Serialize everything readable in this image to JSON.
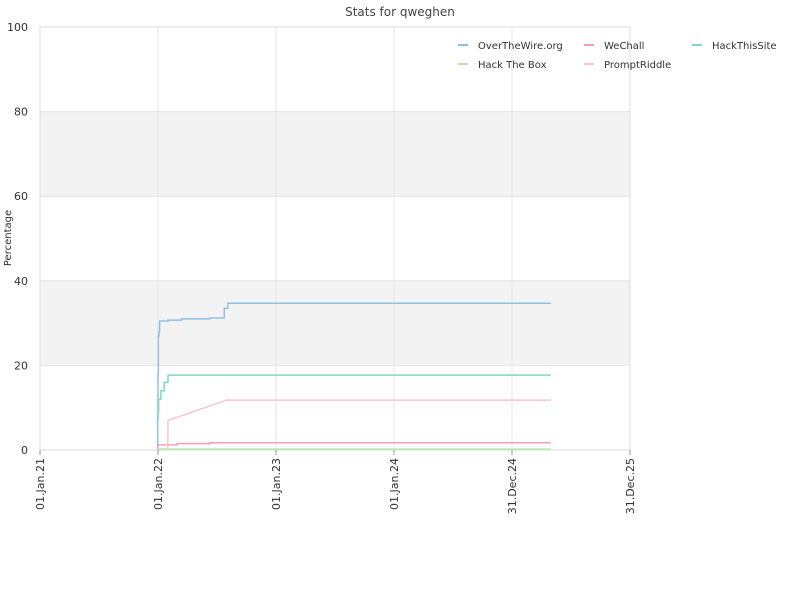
{
  "chart_data": {
    "type": "line",
    "title": "Stats for qweghen",
    "ylabel": "Percentage",
    "xlabel": "",
    "ylim": [
      0,
      100
    ],
    "yticks": [
      0,
      20,
      40,
      60,
      80,
      100
    ],
    "xlim": [
      "2021-01-01",
      "2025-12-31"
    ],
    "xticks": [
      {
        "date": "2021-01-01",
        "label": "01.Jan.21"
      },
      {
        "date": "2022-01-01",
        "label": "01.Jan.22"
      },
      {
        "date": "2023-01-01",
        "label": "01.Jan.23"
      },
      {
        "date": "2024-01-01",
        "label": "01.Jan.24"
      },
      {
        "date": "2024-12-31",
        "label": "31.Dec.24"
      },
      {
        "date": "2025-12-31",
        "label": "31.Dec.25"
      }
    ],
    "grid": true,
    "alternating_bands": true,
    "legend_position": "top-right",
    "series": [
      {
        "name": "OverTheWire.org",
        "color": "#8fbfe6",
        "step": true,
        "points": [
          [
            "2021-12-30",
            0
          ],
          [
            "2021-12-31",
            7
          ],
          [
            "2022-01-01",
            18
          ],
          [
            "2022-01-02",
            27
          ],
          [
            "2022-01-04",
            28
          ],
          [
            "2022-01-06",
            30.5
          ],
          [
            "2022-02-01",
            30.7
          ],
          [
            "2022-03-15",
            31
          ],
          [
            "2022-06-10",
            31.2
          ],
          [
            "2022-07-25",
            33.5
          ],
          [
            "2022-08-05",
            34.7
          ],
          [
            "2025-04-30",
            34.7
          ]
        ]
      },
      {
        "name": "WeChall",
        "color": "#f2a0b8",
        "step": true,
        "points": [
          [
            "2021-12-30",
            0
          ],
          [
            "2022-01-01",
            1.2
          ],
          [
            "2022-03-01",
            1.5
          ],
          [
            "2022-06-10",
            1.7
          ],
          [
            "2025-04-30",
            1.7
          ]
        ]
      },
      {
        "name": "HackThisSite",
        "color": "#7fd9c0",
        "step": true,
        "points": [
          [
            "2021-12-30",
            7
          ],
          [
            "2021-12-31",
            9
          ],
          [
            "2022-01-03",
            12
          ],
          [
            "2022-01-10",
            14
          ],
          [
            "2022-01-20",
            16
          ],
          [
            "2022-02-01",
            17.7
          ],
          [
            "2025-04-30",
            17.7
          ]
        ]
      },
      {
        "name": "Hack The Box",
        "color": "#b4e6a8",
        "step": true,
        "points": [
          [
            "2021-12-30",
            0
          ],
          [
            "2022-01-01",
            0.2
          ],
          [
            "2025-04-30",
            0.2
          ]
        ]
      },
      {
        "name": "PromptRiddle",
        "color": "#f7c6c8",
        "step": false,
        "points": [
          [
            "2022-01-31",
            0
          ],
          [
            "2022-02-01",
            7
          ],
          [
            "2022-08-01",
            11.8
          ],
          [
            "2025-04-30",
            11.8
          ]
        ]
      }
    ]
  }
}
